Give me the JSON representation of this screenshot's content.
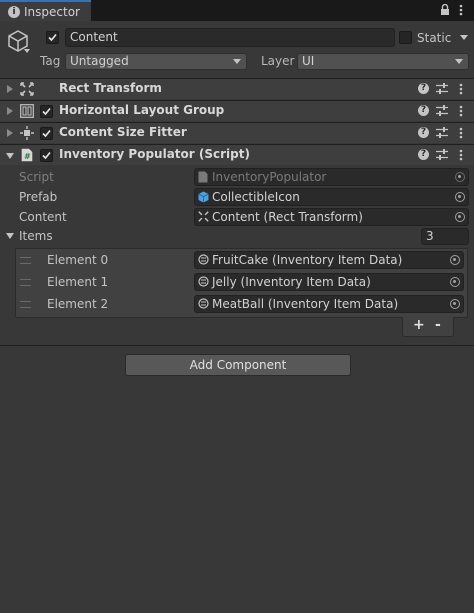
{
  "tab": {
    "label": "Inspector",
    "info_icon": "info-icon",
    "lock_icon": "lock-icon",
    "menu_icon": "kebab-menu-icon"
  },
  "gameobject": {
    "icon": "cube-icon",
    "active": true,
    "name": "Content",
    "static_label": "Static",
    "static": false,
    "tag_label": "Tag",
    "tag_value": "Untagged",
    "layer_label": "Layer",
    "layer_value": "UI"
  },
  "components": [
    {
      "title": "Rect Transform",
      "icon": "rect-transform-icon",
      "has_checkbox": false,
      "expanded": false
    },
    {
      "title": "Horizontal Layout Group",
      "icon": "horizontal-layout-icon",
      "has_checkbox": true,
      "enabled": true,
      "expanded": false
    },
    {
      "title": "Content Size Fitter",
      "icon": "content-size-fitter-icon",
      "has_checkbox": true,
      "enabled": true,
      "expanded": false
    },
    {
      "title": "Inventory Populator (Script)",
      "icon": "script-icon",
      "has_checkbox": true,
      "enabled": true,
      "expanded": true
    }
  ],
  "script_component": {
    "fields": [
      {
        "label": "Script",
        "value": "InventoryPopulator",
        "icon": "script-asset-icon",
        "disabled": true
      },
      {
        "label": "Prefab",
        "value": "CollectibleIcon",
        "icon": "prefab-icon",
        "disabled": false
      },
      {
        "label": "Content",
        "value": "Content (Rect Transform)",
        "icon": "rect-transform-icon",
        "disabled": false
      }
    ],
    "items": {
      "label": "Items",
      "count": "3",
      "elements": [
        {
          "label": "Element 0",
          "value": "FruitCake (Inventory Item Data)",
          "icon": "scriptable-object-icon"
        },
        {
          "label": "Element 1",
          "value": "Jelly (Inventory Item Data)",
          "icon": "scriptable-object-icon"
        },
        {
          "label": "Element 2",
          "value": "MeatBall (Inventory Item Data)",
          "icon": "scriptable-object-icon"
        }
      ],
      "add_label": "+",
      "remove_label": "-"
    }
  },
  "add_component_label": "Add Component",
  "colors": {
    "accent": "#3a72b0",
    "background": "#383838",
    "field": "#2a2a2a"
  }
}
